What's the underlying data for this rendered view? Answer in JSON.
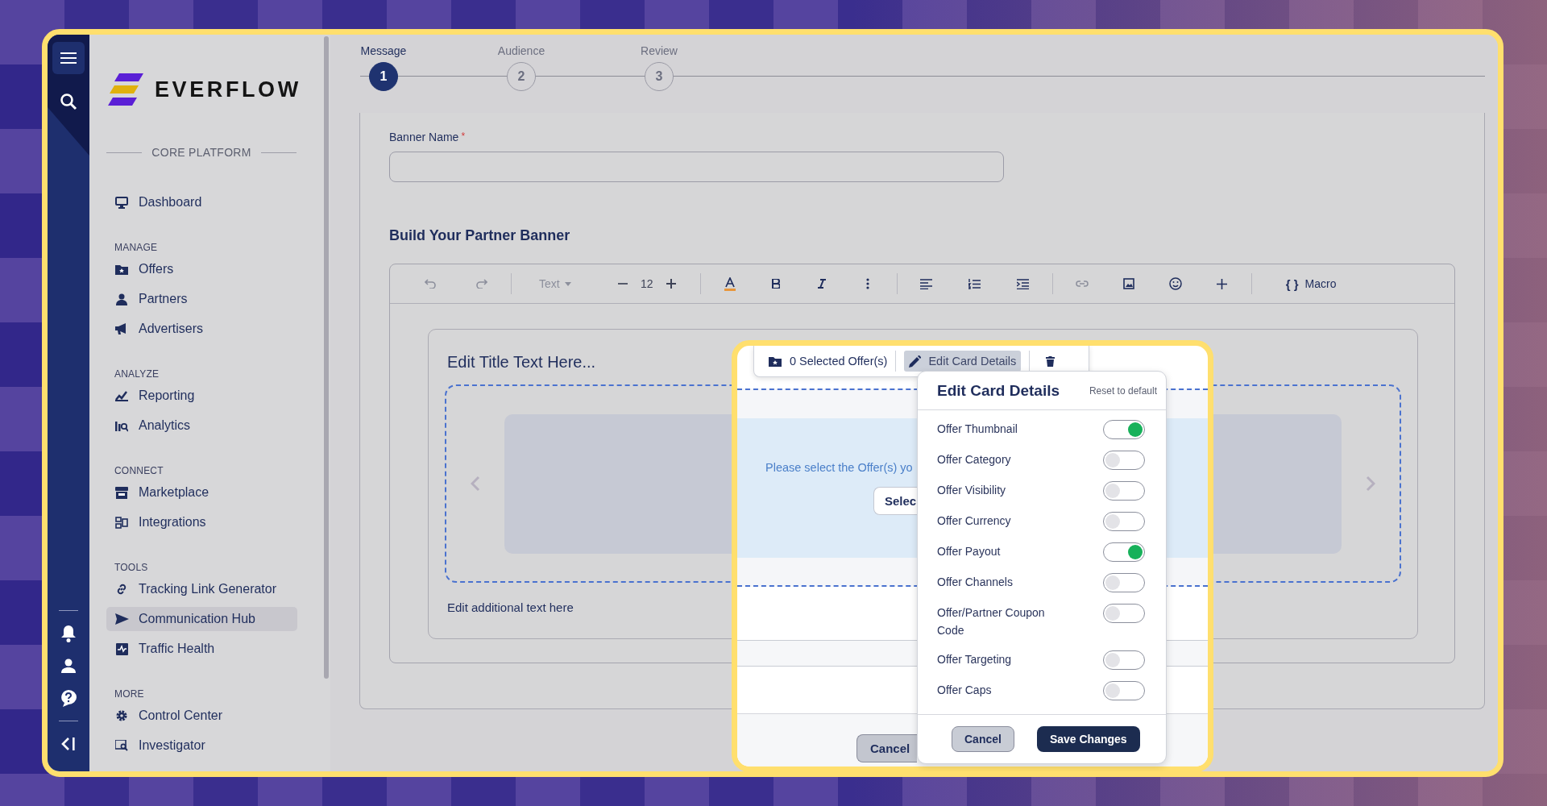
{
  "logo": {
    "name": "EVERFLOW"
  },
  "sidebar": {
    "section_title": "CORE PLATFORM",
    "groups": [
      {
        "items": [
          {
            "label": "Dashboard",
            "selected": false
          }
        ]
      },
      {
        "heading": "MANAGE",
        "items": [
          {
            "label": "Offers",
            "selected": false
          },
          {
            "label": "Partners",
            "selected": false
          },
          {
            "label": "Advertisers",
            "selected": false
          }
        ]
      },
      {
        "heading": "ANALYZE",
        "items": [
          {
            "label": "Reporting",
            "selected": false
          },
          {
            "label": "Analytics",
            "selected": false
          }
        ]
      },
      {
        "heading": "CONNECT",
        "items": [
          {
            "label": "Marketplace",
            "selected": false
          },
          {
            "label": "Integrations",
            "selected": false
          }
        ]
      },
      {
        "heading": "TOOLS",
        "items": [
          {
            "label": "Tracking Link Generator",
            "selected": false
          },
          {
            "label": "Communication Hub",
            "selected": true
          },
          {
            "label": "Traffic Health",
            "selected": false
          }
        ]
      },
      {
        "heading": "MORE",
        "items": [
          {
            "label": "Control Center",
            "selected": false
          },
          {
            "label": "Investigator",
            "selected": false
          }
        ]
      }
    ]
  },
  "stepper": {
    "steps": [
      {
        "label": "Message",
        "number": "1",
        "selected": true
      },
      {
        "label": "Audience",
        "number": "2",
        "selected": false
      },
      {
        "label": "Review",
        "number": "3",
        "selected": false
      }
    ]
  },
  "form": {
    "banner_name": {
      "label": "Banner Name",
      "required_mark": "*"
    },
    "section_title": "Build Your Partner Banner",
    "editor": {
      "toolbar": {
        "font_style": "Text",
        "font_size": "12",
        "macro_icon": "{ }",
        "macro": "Macro"
      },
      "card": {
        "title": "Edit Title Text Here...",
        "additional_text": "Edit additional text here"
      }
    }
  },
  "card_toolbar": {
    "selected_offers": "0 Selected Offer(s)",
    "edit_button": {
      "label": "Edit Card Details",
      "selected": true
    }
  },
  "offer_prompt": {
    "text": "Please select the Offer(s) yo",
    "button": "Selec"
  },
  "footer": {
    "cancel": "Cancel"
  },
  "card_details": {
    "title": "Edit Card Details",
    "reset": "Reset to default",
    "toggles": [
      {
        "label": "Offer Thumbnail",
        "on": true
      },
      {
        "label": "Offer Category",
        "on": false
      },
      {
        "label": "Offer Visibility",
        "on": false
      },
      {
        "label": "Offer Currency",
        "on": false
      },
      {
        "label": "Offer Payout",
        "on": true
      },
      {
        "label": "Offer Channels",
        "on": false
      },
      {
        "label": "Offer/Partner Coupon Code",
        "on": false
      },
      {
        "label": "Offer Targeting",
        "on": false
      },
      {
        "label": "Offer Caps",
        "on": false
      }
    ],
    "cancel": "Cancel",
    "save": "Save Changes"
  }
}
